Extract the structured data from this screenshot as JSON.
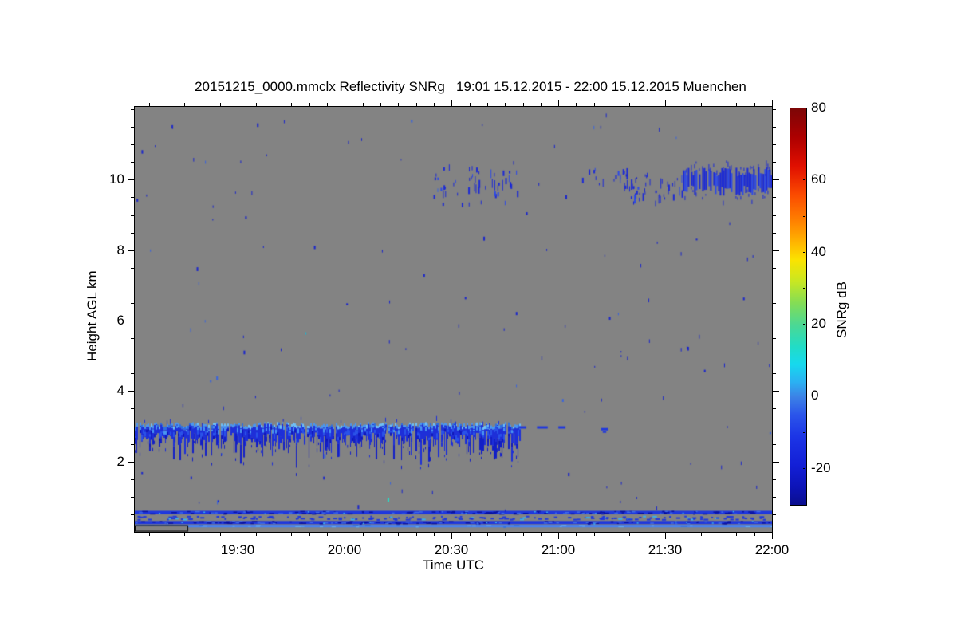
{
  "figure": {
    "title": "20151215_0000.mmclx Reflectivity SNRg   19:01 15.12.2015 - 22:00 15.12.2015 Muenchen"
  },
  "chart_data": {
    "type": "heatmap",
    "title": "20151215_0000.mmclx Reflectivity SNRg   19:01 15.12.2015 - 22:00 15.12.2015 Muenchen",
    "xlabel": "Time UTC",
    "ylabel": "Height AGL km",
    "colorbar_label": "SNRg dB",
    "x_range": [
      "19:01",
      "22:00"
    ],
    "y_range_km": [
      0,
      12.07
    ],
    "z_range_db": [
      -30,
      80
    ],
    "x_ticks": [
      "19:30",
      "20:00",
      "20:30",
      "21:00",
      "21:30",
      "22:00"
    ],
    "x_minor_step_min": 5,
    "y_ticks": [
      2,
      4,
      6,
      8,
      10
    ],
    "y_minor_step_km": 0.5,
    "colorbar_ticks": [
      80,
      60,
      40,
      20,
      0,
      -20
    ],
    "colorbar_minor_step_db": 10,
    "colorbar_stops": [
      [
        80,
        "#7c0607"
      ],
      [
        72,
        "#ad0000"
      ],
      [
        64,
        "#e00f00"
      ],
      [
        56,
        "#fb4b00"
      ],
      [
        48,
        "#ff8700"
      ],
      [
        42,
        "#ffbc00"
      ],
      [
        38,
        "#fbe300"
      ],
      [
        32,
        "#c8e722"
      ],
      [
        26,
        "#84dd55"
      ],
      [
        20,
        "#4cd893"
      ],
      [
        14,
        "#22dcc5"
      ],
      [
        9,
        "#16d9ee"
      ],
      [
        4,
        "#2bb0f2"
      ],
      [
        0,
        "#3c82e6"
      ],
      [
        -5,
        "#2b55ea"
      ],
      [
        -11,
        "#1c35e6"
      ],
      [
        -19,
        "#131fd6"
      ],
      [
        -25,
        "#0d14b8"
      ],
      [
        -30,
        "#0a0e8e"
      ]
    ],
    "palette": {
      "background": "#838383",
      "cloud_core": "#1e2fd8",
      "cloud_light": "#4a96f0",
      "cloud_lighter": "#6fc0f6",
      "cloud_mid": "#2f6fe0",
      "cloud_bright_seg": "#2a52e8",
      "cloud_dark": "#1018b8",
      "streak": "#131fc6",
      "cirrus": "#1c2ad6",
      "cirrus_light": "#2c49e8",
      "noise": "#1a26cc",
      "noise_light": "#3a64dd",
      "noise_cyan": "#18b6d8",
      "stripe_blue": "#2038dd",
      "stripe_dark_fleck": "#0a12a2",
      "stripe_bright_fleck": "#3f6ce8",
      "stripe_cyan_fleck": "#38b0f0",
      "light_stripe": "#4682f0",
      "light_stripe_hi": "#5fa8f4",
      "light_stripe_lo": "#2f6fe0"
    },
    "features": {
      "low_cloud_layer": {
        "t": [
          "19:01",
          "20:49"
        ],
        "top_km": 3.05,
        "base_km": 2.5,
        "fallstreak_min_km": 1.8
      },
      "low_cloud_dashes": [
        {
          "t": [
            "20:49",
            "20:51"
          ],
          "km": 3.0
        },
        {
          "t": [
            "20:54",
            "20:57"
          ],
          "km": 3.0
        },
        {
          "t": [
            "21:00",
            "21:02"
          ],
          "km": 3.0
        },
        {
          "t": [
            "21:12",
            "21:14"
          ],
          "km": 2.95
        }
      ],
      "cirrus_patches": [
        {
          "t": [
            "20:24",
            "20:50"
          ],
          "km": [
            9.35,
            10.5
          ],
          "density": 0.42,
          "solid": false
        },
        {
          "t": [
            "21:06",
            "21:20"
          ],
          "km": [
            9.8,
            10.5
          ],
          "density": 0.32,
          "solid": false
        },
        {
          "t": [
            "21:20",
            "21:35"
          ],
          "km": [
            9.4,
            10.3
          ],
          "density": 0.55,
          "solid": false
        },
        {
          "t": [
            "21:35",
            "22:00"
          ],
          "km": [
            9.55,
            10.35
          ],
          "density": 0.9,
          "solid": true
        }
      ],
      "surface_stripes": [
        {
          "km": [
            0.5,
            0.6
          ],
          "style": "solid_with_dark_flecks"
        },
        {
          "km": [
            0.32,
            0.46
          ],
          "style": "speckle_band"
        },
        {
          "km": [
            0.22,
            0.31
          ],
          "style": "solid_with_dark_flecks"
        },
        {
          "km": [
            0.13,
            0.2
          ],
          "style": "solid_light"
        }
      ],
      "data_gap_box": {
        "t": [
          "19:01",
          "19:16"
        ],
        "km": [
          0,
          0.19
        ]
      },
      "special_specks": [
        {
          "t": "20:12",
          "km": 0.97,
          "color": "#24e0c8"
        }
      ],
      "noise_speck_count": 140
    }
  }
}
